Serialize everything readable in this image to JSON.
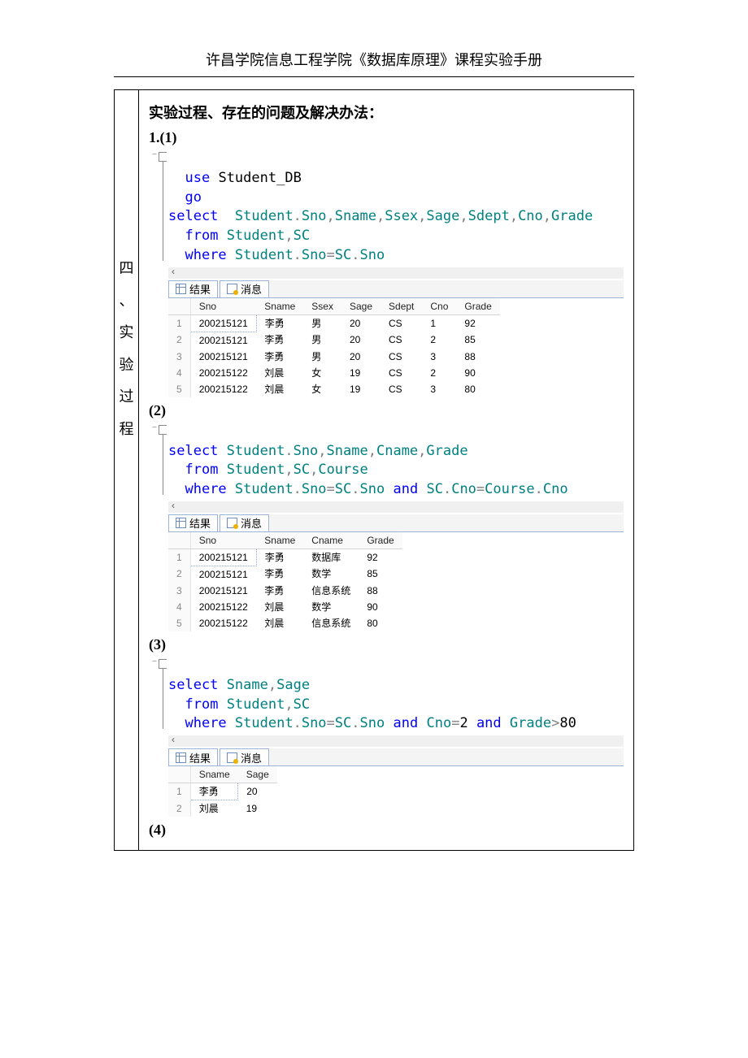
{
  "page_header": "许昌学院信息工程学院《数据库原理》课程实验手册",
  "side_label": [
    "四",
    "、",
    "实",
    "验",
    "过",
    "程"
  ],
  "section_title": "实验过程、存在的问题及解决办法：",
  "labels": {
    "l11": "1.(1)",
    "l2": "(2)",
    "l3": "(3)",
    "l4": "(4)"
  },
  "tabs": {
    "results": "结果",
    "messages": "消息"
  },
  "sql1": {
    "line1a": "use",
    "line1b": "Student_DB",
    "line2": "go",
    "line3a": "select",
    "line3b": "Student",
    "line3c": "Sno",
    "line3d": "Sname",
    "line3e": "Ssex",
    "line3f": "Sage",
    "line3g": "Sdept",
    "line3h": "Cno",
    "line3i": "Grade",
    "line4a": "from",
    "line4b": "Student",
    "line4c": "SC",
    "line5a": "where",
    "line5b": "Student",
    "line5c": "Sno",
    "line5d": "SC",
    "line5e": "Sno"
  },
  "grid1": {
    "headers": [
      "Sno",
      "Sname",
      "Ssex",
      "Sage",
      "Sdept",
      "Cno",
      "Grade"
    ],
    "rows": [
      [
        "200215121",
        "李勇",
        "男",
        "20",
        "CS",
        "1",
        "92"
      ],
      [
        "200215121",
        "李勇",
        "男",
        "20",
        "CS",
        "2",
        "85"
      ],
      [
        "200215121",
        "李勇",
        "男",
        "20",
        "CS",
        "3",
        "88"
      ],
      [
        "200215122",
        "刘晨",
        "女",
        "19",
        "CS",
        "2",
        "90"
      ],
      [
        "200215122",
        "刘晨",
        "女",
        "19",
        "CS",
        "3",
        "80"
      ]
    ]
  },
  "sql2": {
    "line1a": "select",
    "line1b": "Student",
    "line1c": "Sno",
    "line1d": "Sname",
    "line1e": "Cname",
    "line1f": "Grade",
    "line2a": "from",
    "line2b": "Student",
    "line2c": "SC",
    "line2d": "Course",
    "line3a": "where",
    "line3b": "Student",
    "line3c": "Sno",
    "line3d": "SC",
    "line3e": "Sno",
    "line3f": "and",
    "line3g": "SC",
    "line3h": "Cno",
    "line3i": "Course",
    "line3j": "Cno"
  },
  "grid2": {
    "headers": [
      "Sno",
      "Sname",
      "Cname",
      "Grade"
    ],
    "rows": [
      [
        "200215121",
        "李勇",
        "数据库",
        "92"
      ],
      [
        "200215121",
        "李勇",
        "数学",
        "85"
      ],
      [
        "200215121",
        "李勇",
        "信息系统",
        "88"
      ],
      [
        "200215122",
        "刘晨",
        "数学",
        "90"
      ],
      [
        "200215122",
        "刘晨",
        "信息系统",
        "80"
      ]
    ]
  },
  "sql3": {
    "line1a": "select",
    "line1b": "Sname",
    "line1c": "Sage",
    "line2a": "from",
    "line2b": "Student",
    "line2c": "SC",
    "line3a": "where",
    "line3b": "Student",
    "line3c": "Sno",
    "line3d": "SC",
    "line3e": "Sno",
    "line3f": "and",
    "line3g": "Cno",
    "line3h": "2",
    "line3i": "and",
    "line3j": "Grade",
    "line3k": "80"
  },
  "grid3": {
    "headers": [
      "Sname",
      "Sage"
    ],
    "rows": [
      [
        "李勇",
        "20"
      ],
      [
        "刘晨",
        "19"
      ]
    ]
  }
}
